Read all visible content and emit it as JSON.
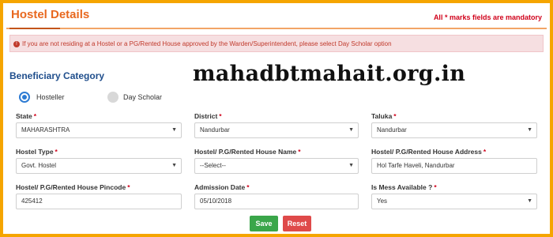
{
  "header": {
    "title": "Hostel Details",
    "mandatory_note": "All * marks fields are mandatory"
  },
  "alert": {
    "text": "If you are not residing at a Hostel or a PG/Rented House approved by the Warden/Superintendent, please select Day Scholar option"
  },
  "section_title": "Beneficiary Category",
  "watermark": "mahadbtmahait.org.in",
  "category": {
    "options": [
      "Hosteller",
      "Day Scholar"
    ],
    "selected": "Hosteller"
  },
  "fields": {
    "state": {
      "label": "State",
      "value": "MAHARASHTRA"
    },
    "district": {
      "label": "District",
      "value": "Nandurbar"
    },
    "taluka": {
      "label": "Taluka",
      "value": "Nandurbar"
    },
    "hostel_type": {
      "label": "Hostel Type",
      "value": "Govt. Hostel"
    },
    "house_name": {
      "label": "Hostel/ P.G/Rented House Name",
      "value": "--Select--"
    },
    "house_address": {
      "label": "Hostel/ P.G/Rented House Address",
      "value": "Hol Tarfe Haveli, Nandurbar"
    },
    "pincode": {
      "label": "Hostel/ P.G/Rented House Pincode",
      "value": "425412"
    },
    "admission_date": {
      "label": "Admission Date",
      "value": "05/10/2018"
    },
    "mess": {
      "label": "Is Mess Available ?",
      "value": "Yes"
    }
  },
  "buttons": {
    "save": "Save",
    "reset": "Reset"
  },
  "colors": {
    "frame": "#f5a500",
    "title": "#e8681f",
    "section": "#1f4e8c",
    "save": "#3aa64a",
    "reset": "#df4a4a"
  }
}
